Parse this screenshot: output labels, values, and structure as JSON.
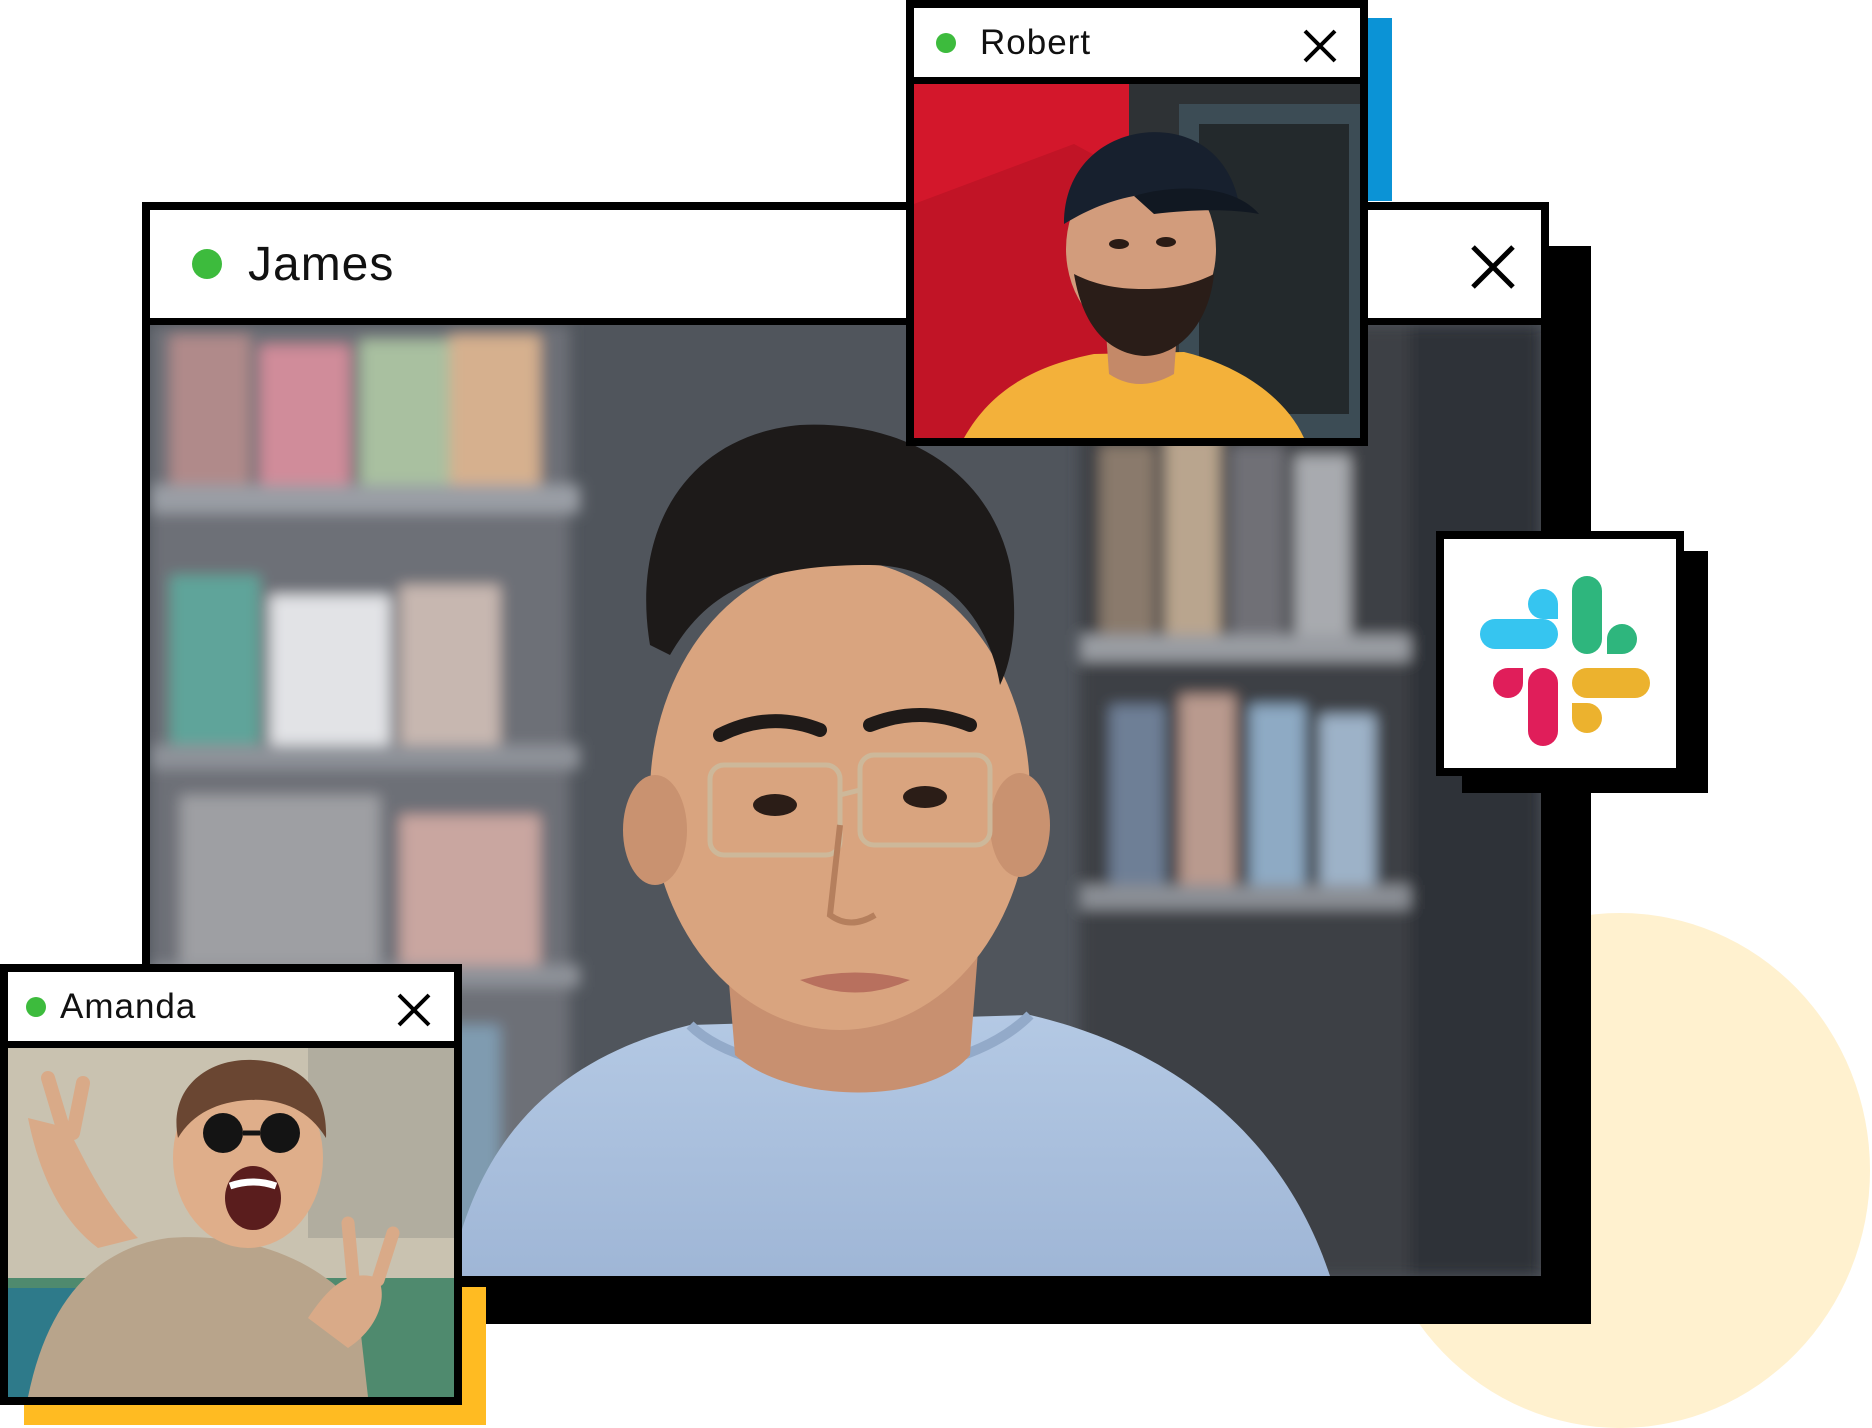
{
  "participants": {
    "james": {
      "name": "James",
      "status": "online"
    },
    "robert": {
      "name": "Robert",
      "status": "online"
    },
    "amanda": {
      "name": "Amanda",
      "status": "online"
    }
  },
  "colors": {
    "online": "#3dbb3d",
    "robert_shadow": "#0b93d6",
    "amanda_shadow": "#ffbb22",
    "background_circle": "#fff1cf",
    "slack_blue": "#36c5f0",
    "slack_green": "#2eb67d",
    "slack_yellow": "#ecb22e",
    "slack_red": "#e01e5a"
  },
  "icons": {
    "status": "green-dot-icon",
    "close": "close-x-icon",
    "app": "slack-logo-icon"
  }
}
